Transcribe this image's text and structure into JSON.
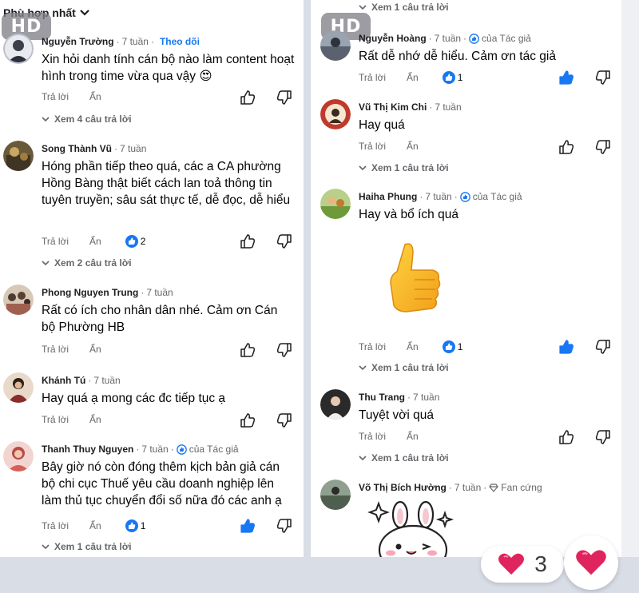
{
  "sort": {
    "label": "Phù hợp nhất"
  },
  "badge": "HD",
  "left": {
    "c1": {
      "name": "Nguyễn Trường",
      "time": "7 tuần",
      "follow": "Theo dõi",
      "text": "Xin hỏi danh tính cán bộ nào làm content hoạt hình trong time vừa qua vậy 😍",
      "reply": "Trả lời",
      "hide": "Ẩn",
      "more": "Xem 4 câu trả lời"
    },
    "c2": {
      "name": "Song Thành Vũ",
      "time": "7 tuần",
      "text": "Hóng phần tiếp theo quá, các a CA phường Hồng Bàng thật biết cách lan toả thông tin tuyên truyền; sâu sát thực tế, dễ đọc, dễ hiểu",
      "reply": "Trả lời",
      "hide": "Ẩn",
      "reactions": "2",
      "more": "Xem 2 câu trả lời"
    },
    "c3": {
      "name": "Phong Nguyen Trung",
      "time": "7 tuần",
      "text": "Rất có ích cho nhân dân nhé. Cảm ơn Cán bộ Phường HB",
      "reply": "Trả lời",
      "hide": "Ẩn"
    },
    "c4": {
      "name": "Khánh Tú",
      "time": "7 tuần",
      "text": "Hay quá ạ mong các đc tiếp tục ạ",
      "reply": "Trả lời",
      "hide": "Ẩn"
    },
    "c5": {
      "name": "Thanh Thuy Nguyen",
      "time": "7 tuần",
      "author": "của Tác giả",
      "text": "Bây giờ nó còn đóng  thêm kịch bản giả cán bộ chi cục Thuế yêu cầu doanh nghiệp lên làm thủ tục chuyển đổi số nữa đó các anh ạ",
      "reply": "Trả lời",
      "hide": "Ẩn",
      "reactions": "1",
      "more": "Xem 1 câu trả lời"
    }
  },
  "right": {
    "top_more": "Xem 1 câu trả lời",
    "c1": {
      "name": "Nguyễn Hoàng",
      "time": "7 tuần",
      "author": "của Tác giả",
      "text": "Rất dễ nhớ dễ hiểu. Cảm ơn tác giả",
      "reply": "Trả lời",
      "hide": "Ẩn",
      "reactions": "1"
    },
    "c2": {
      "name": "Vũ Thị Kim Chi",
      "time": "7 tuần",
      "text": "Hay quá",
      "reply": "Trả lời",
      "hide": "Ẩn",
      "more": "Xem 1 câu trả lời"
    },
    "c3": {
      "name": "Haiha Phung",
      "time": "7 tuần",
      "author": "của Tác giả",
      "text": "Hay và bổ ích quá",
      "reply": "Trả lời",
      "hide": "Ẩn",
      "reactions": "1",
      "more": "Xem 1 câu trả lời"
    },
    "c4": {
      "name": "Thu Trang",
      "time": "7 tuần",
      "text": "Tuyệt vời quá",
      "reply": "Trả lời",
      "hide": "Ẩn",
      "more": "Xem 1 câu trả lời"
    },
    "c5": {
      "name": "Võ Thị Bích Hường",
      "time": "7 tuần",
      "fan": "Fan cứng"
    }
  },
  "reaction_summary": {
    "count": "3"
  },
  "colors": {
    "link": "#1877f2",
    "meta": "#65676b",
    "heart": "#e0245e"
  }
}
